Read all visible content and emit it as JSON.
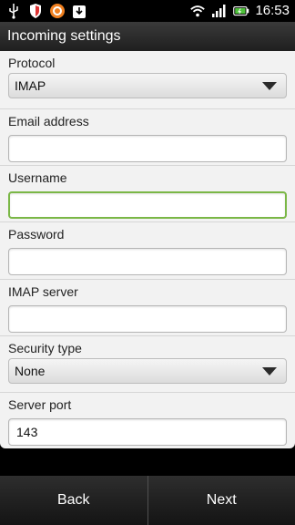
{
  "status_bar": {
    "time": "16:53",
    "left_icons": [
      "usb-icon",
      "shield-icon",
      "avast-icon",
      "download-icon"
    ],
    "right_icons": [
      "wifi-icon",
      "signal-icon",
      "battery-icon"
    ]
  },
  "title": "Incoming settings",
  "fields": {
    "protocol": {
      "label": "Protocol",
      "value": "IMAP"
    },
    "email": {
      "label": "Email address",
      "value": ""
    },
    "username": {
      "label": "Username",
      "value": ""
    },
    "password": {
      "label": "Password",
      "value": ""
    },
    "imap_server": {
      "label": "IMAP server",
      "value": ""
    },
    "security_type": {
      "label": "Security type",
      "value": "None"
    },
    "server_port": {
      "label": "Server port",
      "value": "143"
    }
  },
  "buttons": {
    "back": "Back",
    "next": "Next"
  },
  "colors": {
    "focus_border": "#7ab746",
    "form_bg": "#f2f2f2",
    "bar_bg": "#1f1f1f"
  }
}
